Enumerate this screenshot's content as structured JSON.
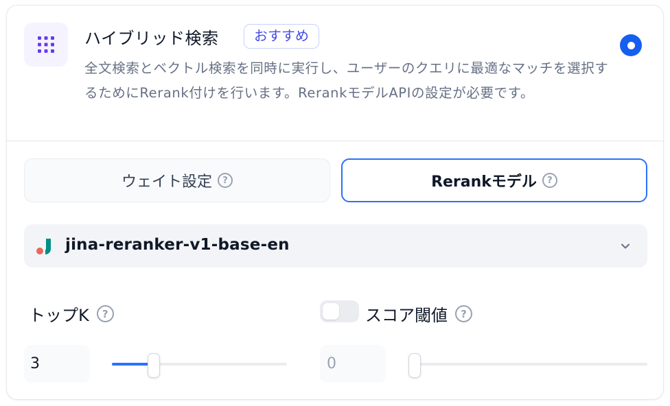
{
  "header": {
    "title": "ハイブリッド検索",
    "badge": "おすすめ",
    "description": "全文検索とベクトル検索を同時に実行し、ユーザーのクエリに最適なマッチを選択するためにRerank付けを行います。RerankモデルAPIの設定が必要です。",
    "icon": "grid-dots-icon",
    "selected": true
  },
  "tabs": [
    {
      "label": "ウェイト設定",
      "active": false
    },
    {
      "label": "Rerankモデル",
      "active": true
    }
  ],
  "model_select": {
    "value": "jina-reranker-v1-base-en",
    "logo": "jina-logo"
  },
  "top_k": {
    "label": "トップK",
    "value": "3",
    "level": 0.22
  },
  "score_threshold": {
    "label": "スコア閾値",
    "enabled": false,
    "value": "0",
    "level": 0.0
  },
  "colors": {
    "accent": "#2970ff",
    "badge": "#444ce7",
    "icon_bg": "#f4f3ff",
    "icon_fg": "#6938ef",
    "logo_red": "#e8675b",
    "logo_teal": "#008f86"
  }
}
